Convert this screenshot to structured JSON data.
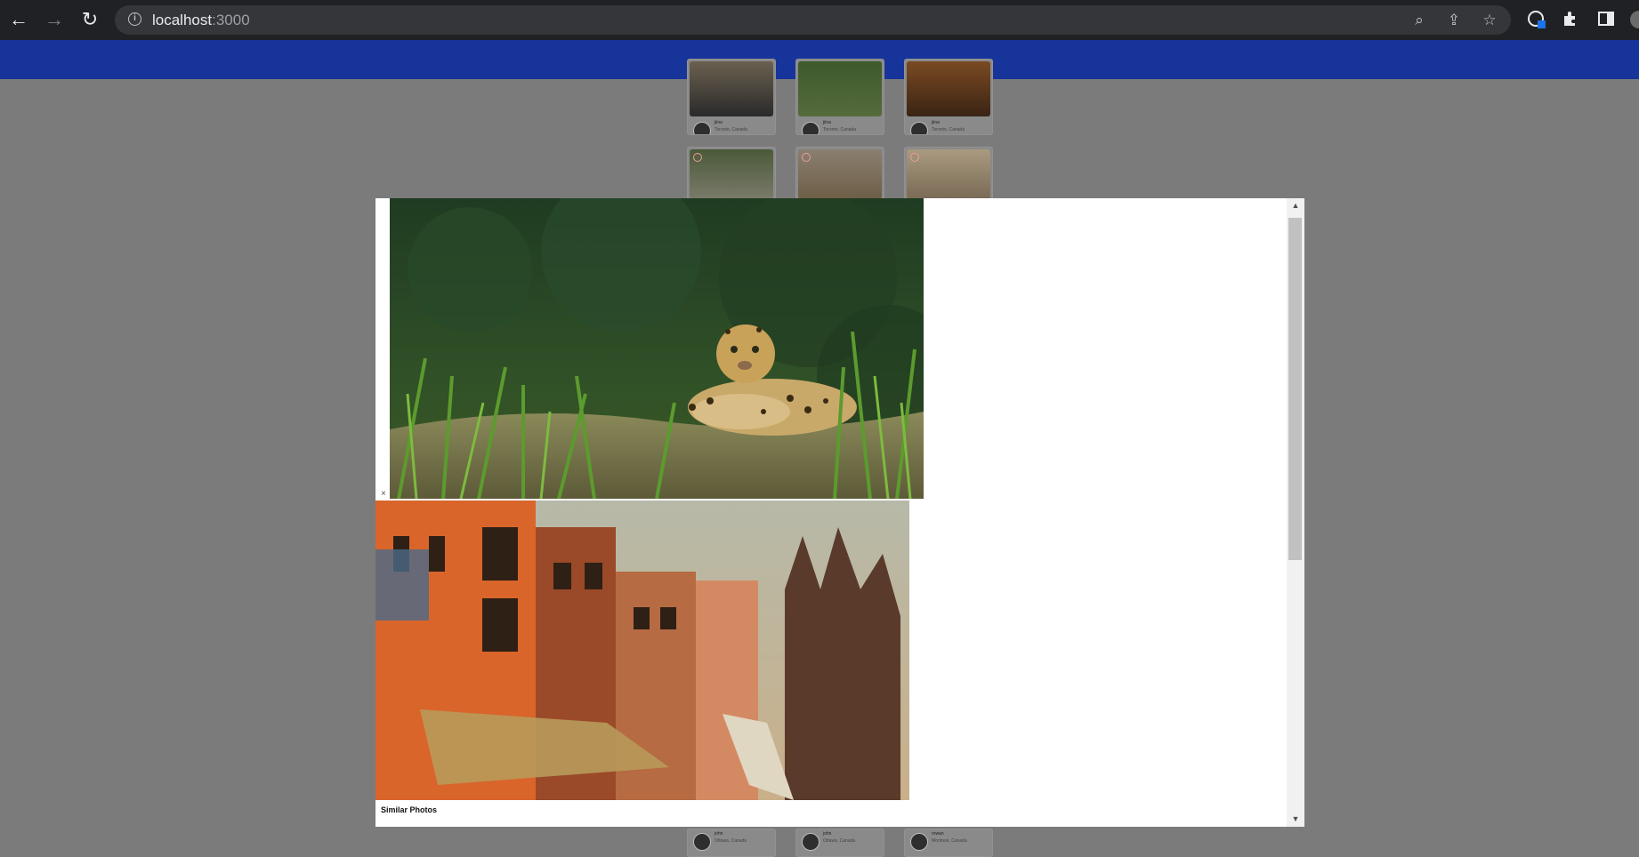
{
  "browser": {
    "url_host": "localhost",
    "url_port": ":3000",
    "back_icon": "arrow-left-icon",
    "forward_icon": "arrow-right-icon",
    "reload_icon": "reload-icon",
    "info_icon": "info-icon",
    "zoom_icon": "zoom-out-icon",
    "share_icon": "share-icon",
    "bookmark_icon": "star-icon",
    "extensions_icon": "puzzle-icon",
    "sidepanel_icon": "side-panel-icon"
  },
  "background_grid": {
    "cards": [
      {
        "name": "jiina",
        "location": "Toronto, Canada"
      },
      {
        "name": "jiina",
        "location": "Toronto, Canada"
      },
      {
        "name": "jiina",
        "location": "Toronto, Canada"
      },
      {
        "name": "",
        "location": ""
      },
      {
        "name": "",
        "location": ""
      },
      {
        "name": "",
        "location": ""
      },
      {
        "name": "john",
        "location": "Ottawa, Canada"
      },
      {
        "name": "john",
        "location": "Ottawa, Canada"
      },
      {
        "name": "rowan",
        "location": "Montreal, Canada"
      }
    ]
  },
  "modal": {
    "close_label": "×",
    "main_photo_alt": "Jaguar resting in grass",
    "similar_photo_alt": "Orange buildings and temple spires street",
    "similar_title": "Similar Photos"
  },
  "colors": {
    "chrome_bg": "#202124",
    "omnibox_bg": "#35363a",
    "app_bar": "#17349a",
    "overlay": "#7b7b7b"
  }
}
